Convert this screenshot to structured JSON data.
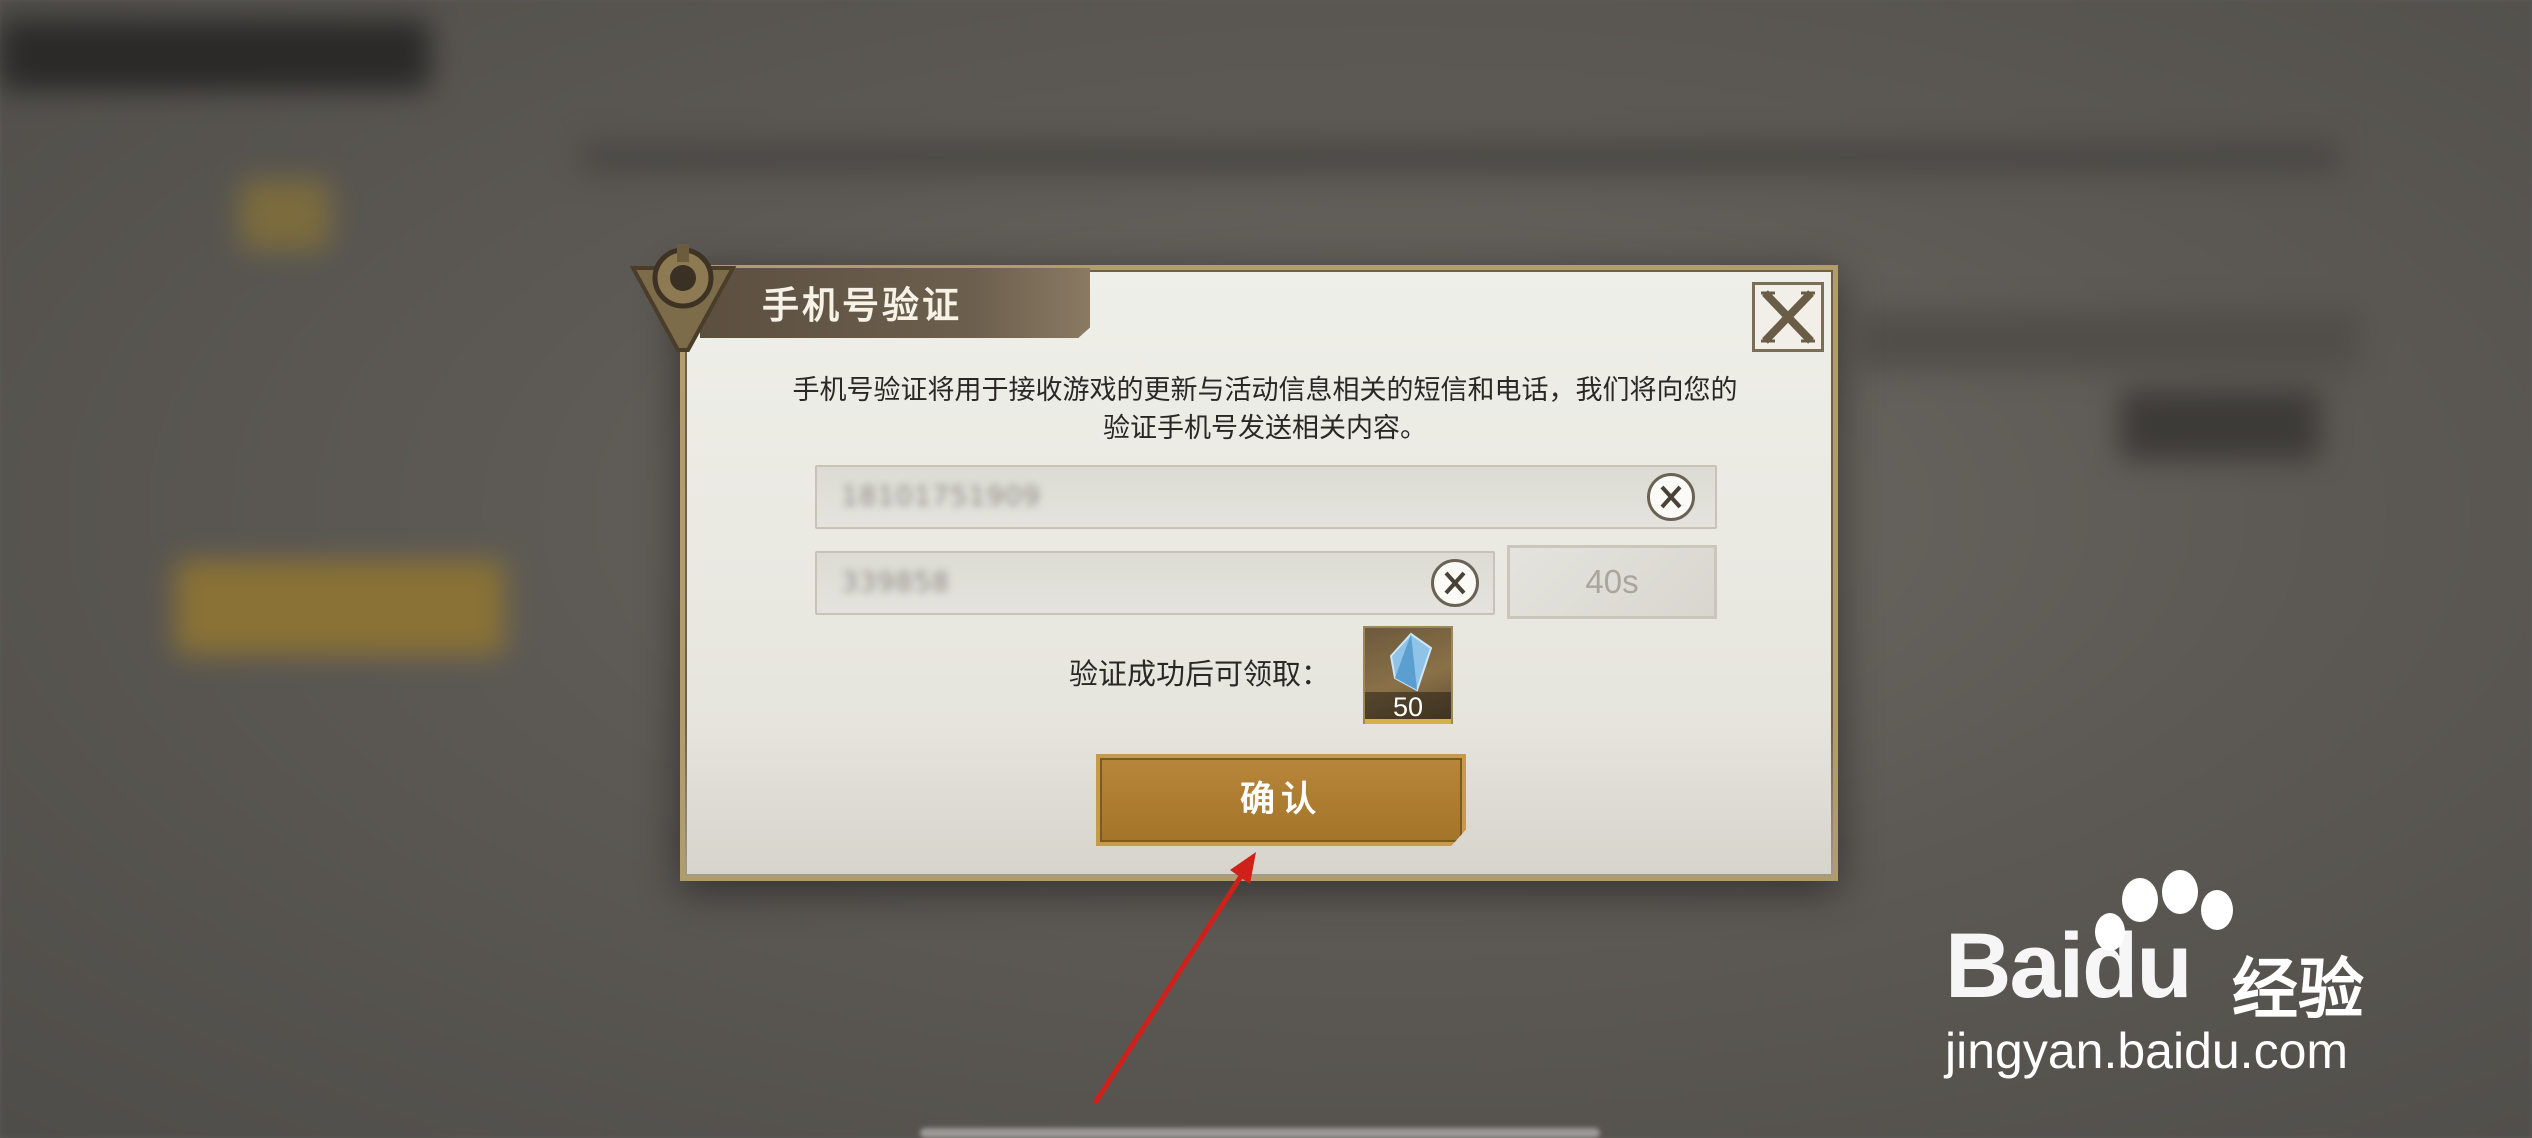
{
  "dialog": {
    "title": "手机号验证",
    "description": "手机号验证将用于接收游戏的更新与活动信息相关的短信和电话，我们将向您的验证手机号发送相关内容。",
    "phone_value": "18101751909",
    "code_value": "339858",
    "countdown": "40s",
    "reward_label": "验证成功后可领取：",
    "reward_quantity": "50",
    "confirm_label": "确认"
  },
  "watermark": {
    "brand": "Baidu",
    "brand_suffix": "经验",
    "url": "jingyan.baidu.com"
  },
  "colors": {
    "accent": "#a4742a",
    "arrow": "#d0201a"
  }
}
